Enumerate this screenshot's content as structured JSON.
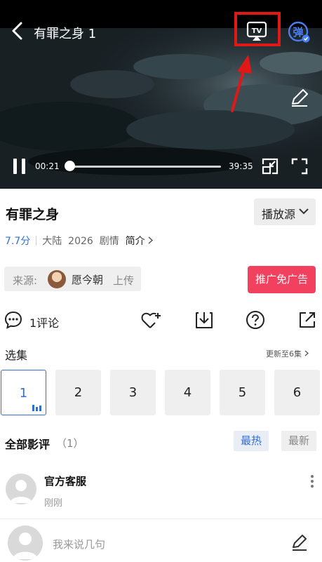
{
  "player": {
    "title": "有罪之身 1",
    "tv_label": "TV",
    "danmu_label": "弹",
    "current_time": "00:21",
    "total_time": "39:35",
    "progress": 0.01
  },
  "info": {
    "title": "有罪之身",
    "source_button": "播放源",
    "score": "7.7分",
    "region": "大陆",
    "year": "2026",
    "genre": "剧情",
    "intro": "简介",
    "from_label": "来源:",
    "uploader_name": "愿今朝",
    "upload_label": "上传",
    "ad_button": "推广免广告"
  },
  "actions": {
    "comment_count": "1评论"
  },
  "episodes": {
    "label": "选集",
    "update_text": "更新至6集",
    "items": [
      "1",
      "2",
      "3",
      "4",
      "5",
      "6"
    ],
    "active": "1"
  },
  "reviews": {
    "title": "全部影评",
    "count": "（1）",
    "sort_hot": "最热",
    "sort_new": "最新",
    "items": [
      {
        "name": "官方客服",
        "time": "刚刚"
      }
    ]
  },
  "composer": {
    "placeholder": "我来说几句"
  },
  "colors": {
    "accent": "#2f6fd8",
    "ad": "#f2405f",
    "highlight": "#e01818"
  }
}
